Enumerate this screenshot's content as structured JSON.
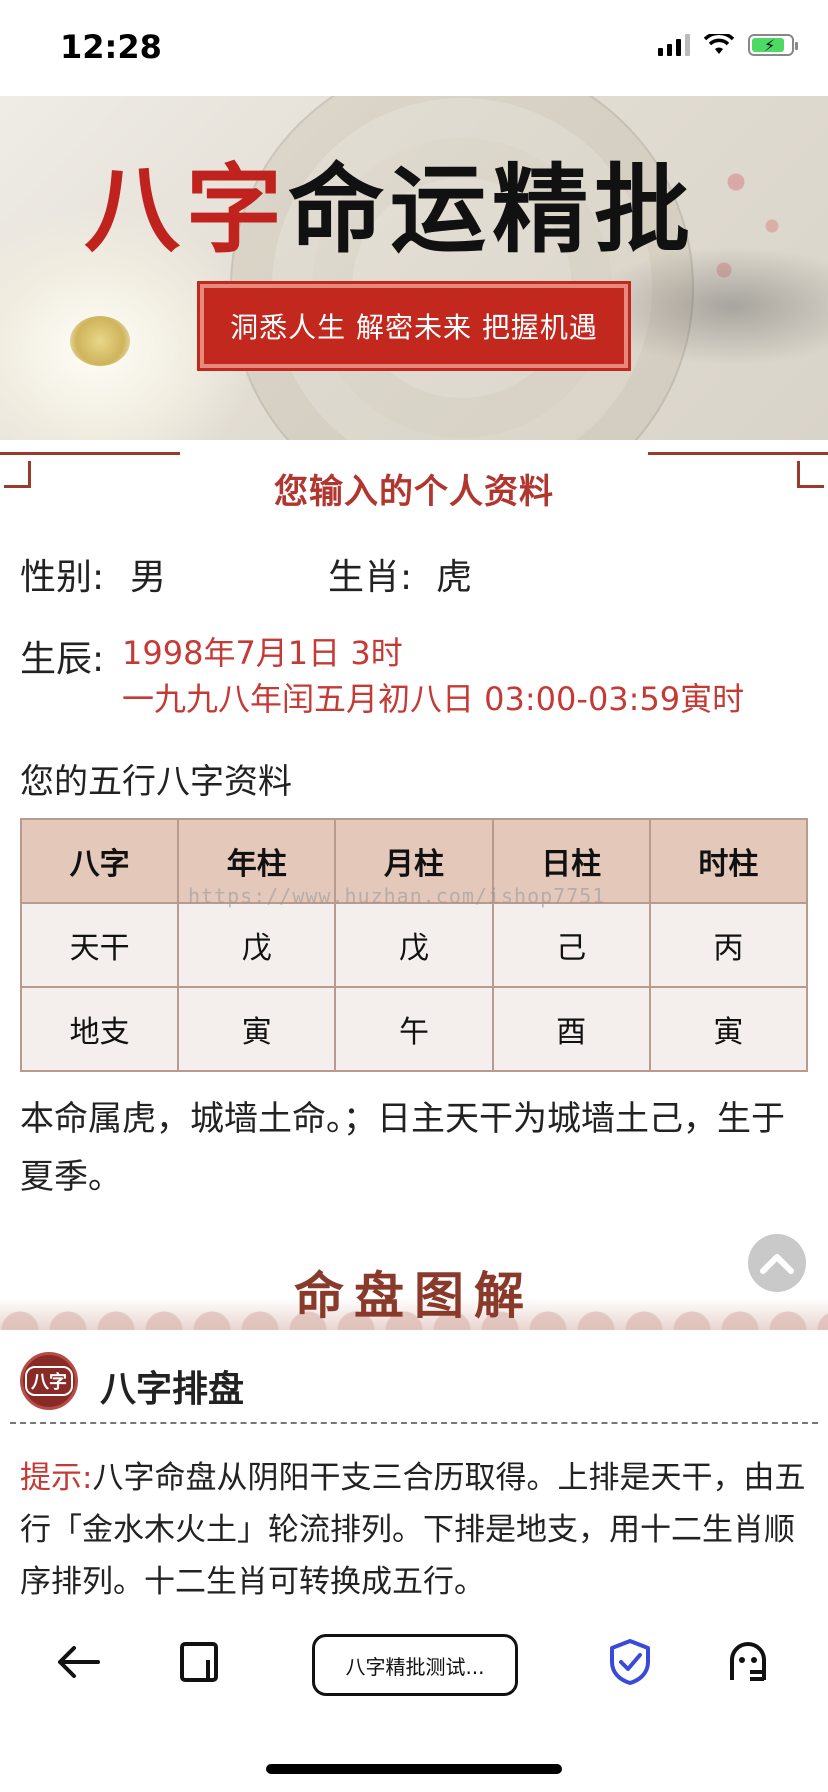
{
  "status_bar": {
    "time": "12:28"
  },
  "banner": {
    "title_red": "八字",
    "title_black": "命运精批",
    "subtitle": "洞悉人生  解密未来  把握机遇"
  },
  "profile": {
    "section_title": "您输入的个人资料",
    "gender_label": "性别:",
    "gender_value": "男",
    "zodiac_label": "生肖:",
    "zodiac_value": "虎",
    "birth_label": "生辰:",
    "birth_solar": "1998年7月1日 3时",
    "birth_lunar": "一九九八年闰五月初八日 03:00-03:59寅时"
  },
  "wuxing": {
    "title": "您的五行八字资料",
    "headers": [
      "八字",
      "年柱",
      "月柱",
      "日柱",
      "时柱"
    ],
    "rows": [
      [
        "天干",
        "戊",
        "戊",
        "己",
        "丙"
      ],
      [
        "地支",
        "寅",
        "午",
        "酉",
        "寅"
      ]
    ],
    "watermark": "https://www.huzhan.com/ishop7751"
  },
  "description": "本命属虎，城墙土命。；日主天干为城墙土己，生于夏季。",
  "mingpan": {
    "banner_title": "命盘图解"
  },
  "paipan": {
    "logo_text": "八字",
    "title": "八字排盘",
    "tip_label": "提示:",
    "tip_text": "八字命盘从阴阳干支三合历取得。上排是天干，由五行「金水木火土」轮流排列。下排是地支，用十二生肖顺序排列。十二生肖可转换成五行。"
  },
  "toolbar": {
    "address": "八字精批测试...",
    "icons": [
      "back-arrow-icon",
      "tabs-icon",
      "shield-check-icon",
      "ghost-icon"
    ]
  },
  "colors": {
    "accent_red": "#c53a35",
    "banner_red": "#c3281f",
    "table_header_bg": "#e4c8ba",
    "table_cell_bg": "#f4efec",
    "shield_blue": "#3a4ad8"
  }
}
